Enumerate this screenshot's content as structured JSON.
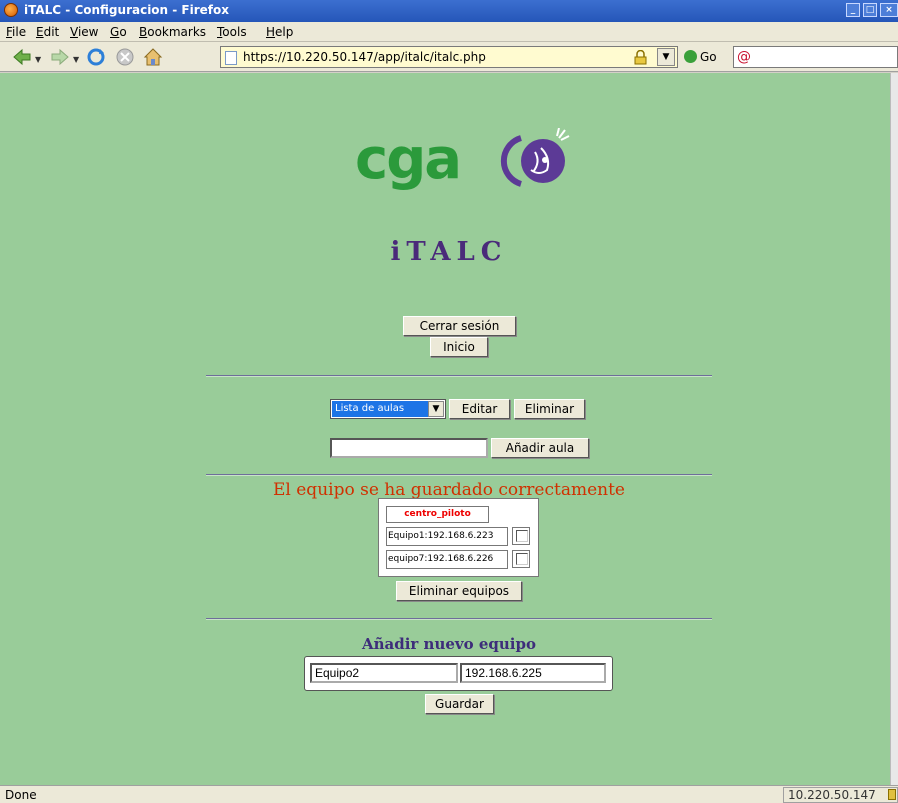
{
  "window": {
    "title": "iTALC - Configuracion - Firefox"
  },
  "menu": {
    "items": [
      {
        "label": "File",
        "accel": "F",
        "rest": "ile"
      },
      {
        "label": "Edit",
        "accel": "E",
        "rest": "dit"
      },
      {
        "label": "View",
        "accel": "V",
        "rest": "iew"
      },
      {
        "label": "Go",
        "accel": "G",
        "rest": "o"
      },
      {
        "label": "Bookmarks",
        "accel": "B",
        "rest": "ookmarks"
      },
      {
        "label": "Tools",
        "accel": "T",
        "rest": "ools"
      },
      {
        "label": "Help",
        "accel": "H",
        "rest": "elp"
      }
    ]
  },
  "nav": {
    "url": "https://10.220.50.147/app/italc/italc.php",
    "go_label": "Go",
    "icons": [
      "back-icon",
      "forward-icon",
      "reload-icon",
      "stop-icon",
      "home-icon"
    ]
  },
  "page": {
    "logo_text": "cga",
    "title": "iTALC",
    "logout_label": "Cerrar sesión",
    "home_label": "Inicio",
    "classroom_select": "Lista de aulas",
    "edit_label": "Editar",
    "delete_label": "Eliminar",
    "new_classroom_value": "",
    "add_classroom_label": "Añadir aula",
    "status_message": "El equipo se ha guardado correctamente",
    "table_header": "centro_piloto",
    "computers": [
      {
        "label": "Equipo1:192.168.6.223",
        "checked": false
      },
      {
        "label": "equipo7:192.168.6.226",
        "checked": false
      }
    ],
    "delete_computers_label": "Eliminar equipos",
    "new_computer_title": "Añadir nuevo equipo",
    "new_computer_name": "Equipo2",
    "new_computer_ip": "192.168.6.225",
    "save_label": "Guardar"
  },
  "status": {
    "text": "Done",
    "host": "10.220.50.147"
  },
  "colors": {
    "page_background": "#99cc99",
    "logo_green": "#2b9a3b",
    "logo_purple": "#5c3a96",
    "status_message": "#d03000",
    "table_header": "#ee0000",
    "select_highlight": "#1d74e6"
  }
}
